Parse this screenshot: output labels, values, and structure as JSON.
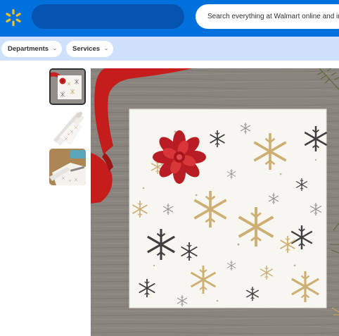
{
  "header": {
    "search": {
      "placeholder": "Search everything at Walmart online and in store"
    },
    "brand_color": "#0071dc",
    "spark_color": "#ffc220"
  },
  "subnav": {
    "departments_label": "Departments",
    "services_label": "Services"
  },
  "product": {
    "thumbnails": [
      "gift-wrap-front",
      "gift-wrap-roll",
      "gift-wrap-in-use"
    ],
    "selected_thumbnail": 1
  }
}
